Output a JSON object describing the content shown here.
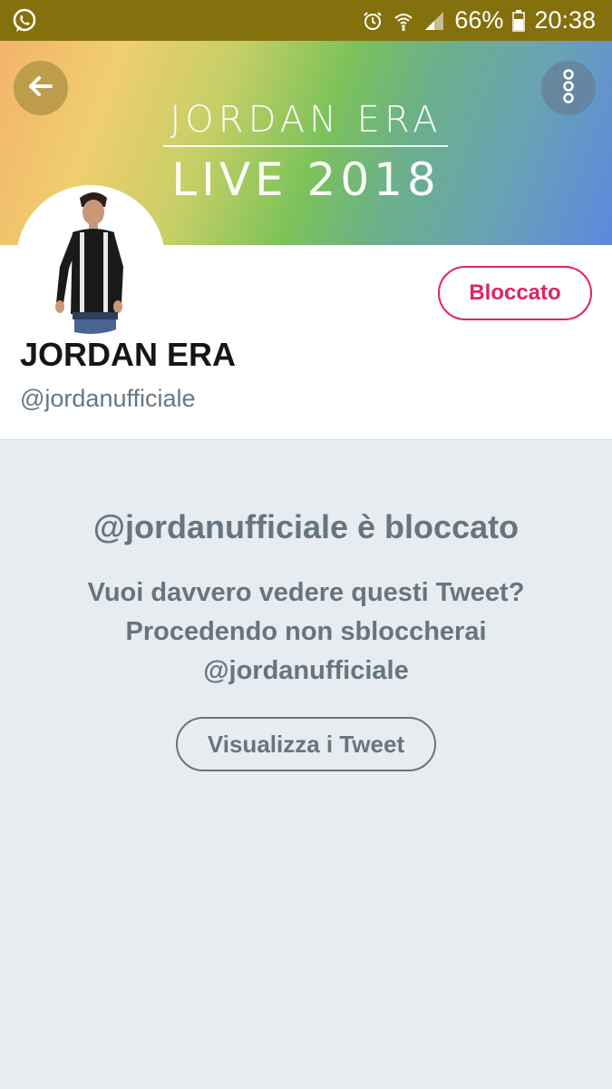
{
  "status_bar": {
    "left_icon": "whatsapp-icon",
    "icons": [
      "alarm-icon",
      "wifi-icon",
      "signal-icon"
    ],
    "battery": "66%",
    "time": "20:38"
  },
  "banner": {
    "line1": "JORDAN ERA",
    "line2": "LIVE 2018",
    "back_icon": "back-arrow-icon",
    "more_icon": "more-vertical-icon"
  },
  "profile": {
    "name": "JORDAN ERA",
    "handle": "@jordanufficiale",
    "blocked_label": "Bloccato"
  },
  "notice": {
    "title": "@jordanufficiale è bloccato",
    "line1": "Vuoi davvero vedere questi Tweet?",
    "line2": "Procedendo non sbloccherai",
    "line3": "@jordanufficiale",
    "button_label": "Visualizza i Tweet"
  },
  "colors": {
    "accent_red": "#e0245e",
    "muted_text": "#66757f",
    "background": "#e6ecf0",
    "status_bar": "#84710d"
  }
}
